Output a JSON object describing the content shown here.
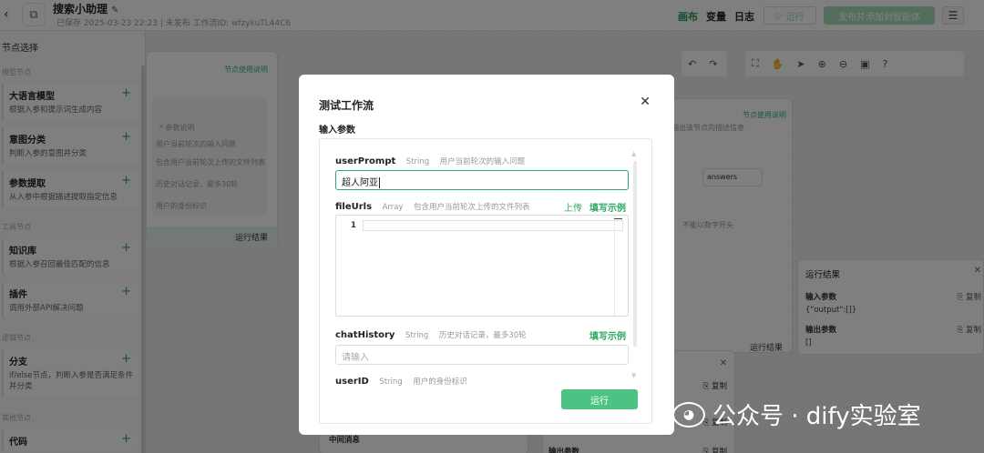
{
  "header": {
    "app_name": "搜索小助理",
    "meta": "已保存 2025-03-23 22:23 | 未发布    工作流ID: wfzykuTL44C6",
    "nav": [
      "画布",
      "变量",
      "日志"
    ],
    "run_label": "运行",
    "publish_label": "发布并添加到智能体"
  },
  "left_panel": {
    "title": "节点选择",
    "groups": [
      "模型节点",
      "工具节点",
      "逻辑节点",
      "其他节点"
    ],
    "nodes": [
      {
        "name": "大语言模型",
        "desc": "根据入参和提示词生成内容"
      },
      {
        "name": "意图分类",
        "desc": "判断入参的意图并分类"
      },
      {
        "name": "参数提取",
        "desc": "从入参中根据描述提取指定信息"
      },
      {
        "name": "知识库",
        "desc": "根据入参召回最佳匹配的信息"
      },
      {
        "name": "插件",
        "desc": "调用外部API解决问题"
      },
      {
        "name": "分支",
        "desc": "if/else节点，判断入参是否满足条件并分类"
      },
      {
        "name": "代码",
        "desc": ""
      }
    ]
  },
  "background": {
    "start_node": {
      "link": "节点使用说明",
      "fields": [
        "* 参数说明",
        "用户当前轮次的输入问题",
        "包含用户当前轮次上传的文件列表",
        "历史对话记录，最多30轮",
        "用户的身份标识"
      ],
      "run_result": "运行结果"
    },
    "right_node": {
      "link": "节点使用说明",
      "subtitle": "输出该节点的描述信息",
      "select_value": "answers",
      "placeholder": "不能以数字开头",
      "run_result": "运行结果"
    },
    "result_panel": {
      "title": "运行结果",
      "input_label": "输入参数",
      "input_value": "{\"output\":[]}",
      "output_label": "输出参数",
      "output_value": "[]",
      "copy_label": "复制"
    },
    "bottom_node": {
      "copy_label": "复制",
      "output_label": "输出参数",
      "mid_label": "中间消息"
    }
  },
  "modal": {
    "title": "测试工作流",
    "section": "输入参数",
    "fields": [
      {
        "name": "userPrompt",
        "type": "String",
        "desc": "用户当前轮次的输入问题",
        "value": "超人阿亚"
      },
      {
        "name": "fileUrls",
        "type": "Array",
        "desc": "包含用户当前轮次上传的文件列表",
        "upload": "上传",
        "example": "填写示例",
        "line_no": "1"
      },
      {
        "name": "chatHistory",
        "type": "String",
        "desc": "历史对话记录，最多30轮",
        "example": "填写示例",
        "placeholder": "请输入"
      },
      {
        "name": "userID",
        "type": "String",
        "desc": "用户的身份标识"
      }
    ],
    "run_label": "运行"
  },
  "watermark": "公众号 · dify实验室"
}
